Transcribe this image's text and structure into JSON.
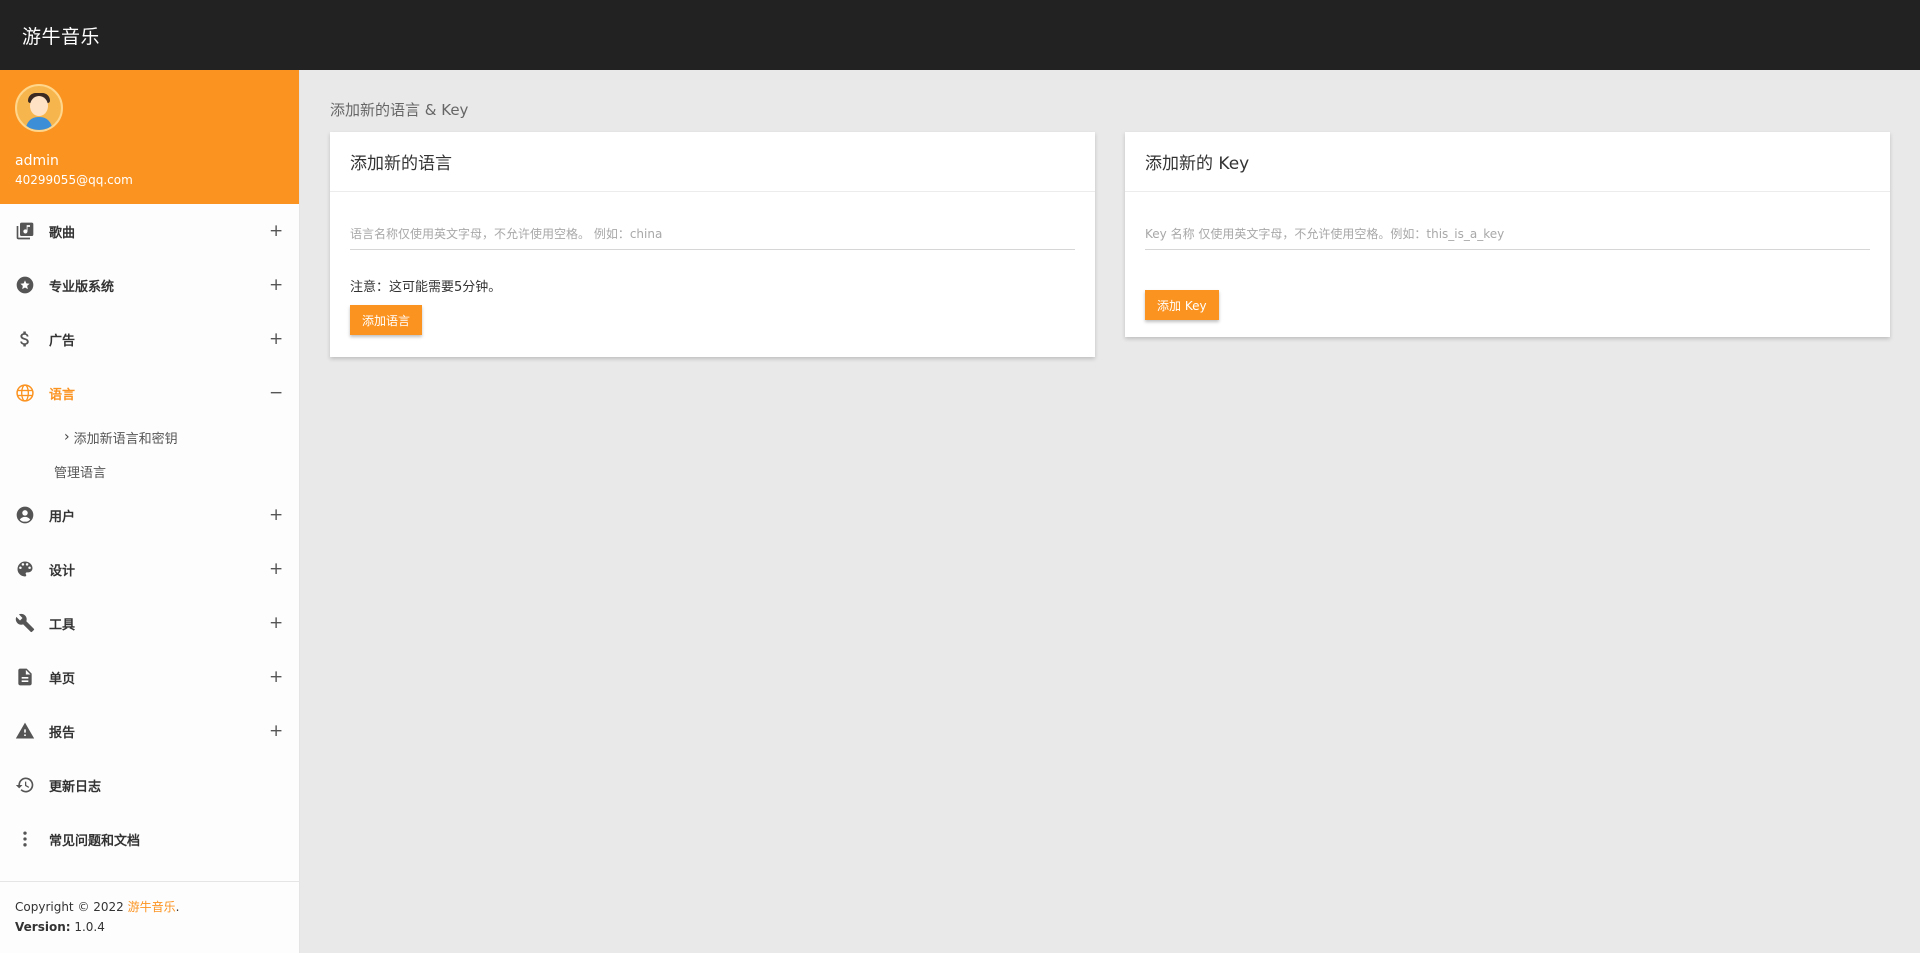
{
  "app": {
    "title": "游牛音乐"
  },
  "user": {
    "name": "admin",
    "email": "40299055@qq.com"
  },
  "sidebar": {
    "items": [
      {
        "label": "歌曲",
        "icon": "music-library-icon",
        "toggle": "+"
      },
      {
        "label": "专业版系统",
        "icon": "star-badge-icon",
        "toggle": "+"
      },
      {
        "label": "广告",
        "icon": "dollar-icon",
        "toggle": "+"
      },
      {
        "label": "语言",
        "icon": "globe-icon",
        "toggle": "−",
        "active": true
      },
      {
        "label": "用户",
        "icon": "account-circle-icon",
        "toggle": "+"
      },
      {
        "label": "设计",
        "icon": "palette-icon",
        "toggle": "+"
      },
      {
        "label": "工具",
        "icon": "wrench-icon",
        "toggle": "+"
      },
      {
        "label": "单页",
        "icon": "document-icon",
        "toggle": "+"
      },
      {
        "label": "报告",
        "icon": "warning-icon",
        "toggle": "+"
      },
      {
        "label": "更新日志",
        "icon": "history-icon",
        "toggle": ""
      },
      {
        "label": "常见问题和文档",
        "icon": "more-vertical-icon",
        "toggle": ""
      }
    ],
    "language_submenu": [
      {
        "label": "添加新语言和密钥"
      },
      {
        "label": "管理语言"
      }
    ]
  },
  "footer": {
    "copyright_prefix": "Copyright © 2022 ",
    "copyright_link": "游牛音乐",
    "copyright_suffix": ".",
    "version_label": "Version:",
    "version_value": " 1.0.4"
  },
  "main": {
    "breadcrumb": "添加新的语言 & Key",
    "language_card": {
      "title": "添加新的语言",
      "placeholder": "语言名称仅使用英文字母，不允许使用空格。 例如：china",
      "note": "注意：这可能需要5分钟。",
      "button": "添加语言"
    },
    "key_card": {
      "title": "添加新的 Key",
      "placeholder": "Key 名称 仅使用英文字母，不允许使用空格。例如：this_is_a_key",
      "button": "添加 Key"
    }
  },
  "colors": {
    "accent": "#fb9320",
    "topbar": "#222222",
    "background": "#e9e9e9"
  }
}
